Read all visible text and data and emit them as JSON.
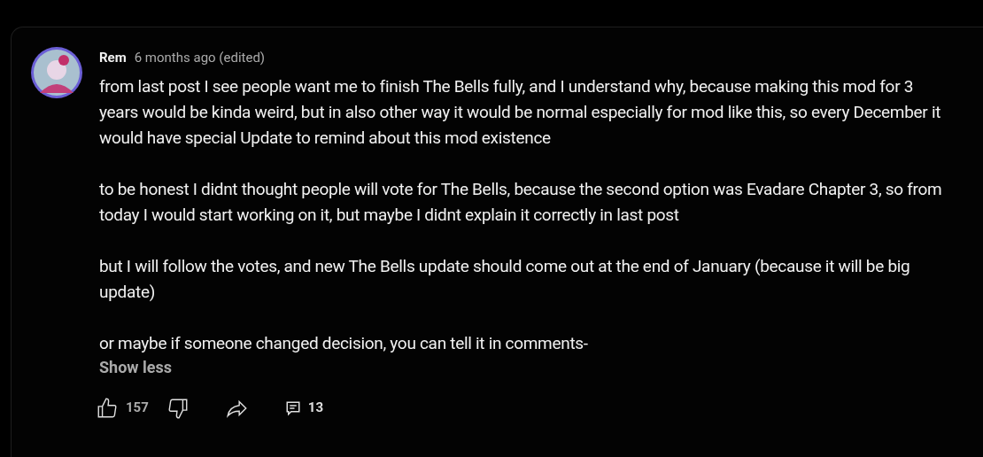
{
  "post": {
    "author": "Rem",
    "time": "6 months ago (edited)",
    "paragraphs": [
      "from last post I see people want me to finish The Bells fully, and I understand why, because making this mod for 3 years would be kinda weird, but in also other way it would be normal especially for mod like this, so every December it would have special Update to remind about this mod existence",
      "to be honest I didnt thought people will vote for The Bells, because the second option was Evadare Chapter 3, so from today I would start working on it, but maybe I didnt explain it correctly in last post",
      "but I will follow the votes, and new The Bells update should come out at the end of January (because it will be big update)",
      "or maybe if someone changed decision, you can tell it in comments-"
    ],
    "toggle": "Show less",
    "likes": "157",
    "comments": "13"
  }
}
